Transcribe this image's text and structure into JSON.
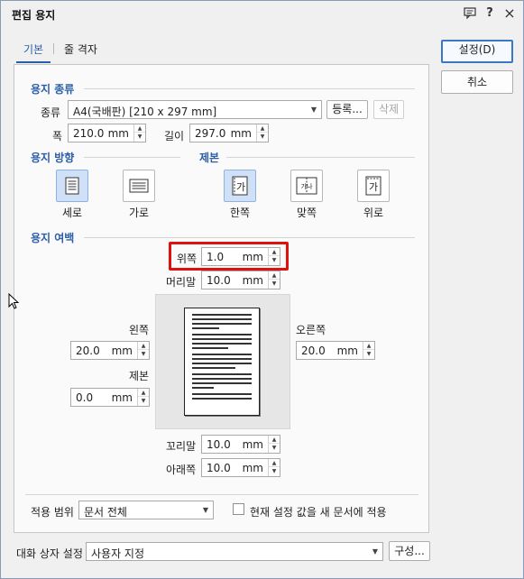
{
  "window": {
    "title": "편집 용지",
    "icons": {
      "help_dialog": "chat-icon",
      "help": "?",
      "close": "×"
    }
  },
  "tabs": [
    {
      "label": "기본"
    },
    {
      "label": "줄 격자"
    }
  ],
  "paper_type": {
    "section": "용지 종류",
    "type_label": "종류",
    "type_value": "A4(국배판) [210 x 297 mm]",
    "register_button": "등록...",
    "delete_button": "삭제",
    "width_label": "폭",
    "width_value": "210.0",
    "width_unit": "mm",
    "height_label": "길이",
    "height_value": "297.0",
    "height_unit": "mm"
  },
  "orientation": {
    "section": "용지 방향",
    "portrait": "세로",
    "landscape": "가로",
    "selected": "세로"
  },
  "binding": {
    "section": "제본",
    "single": "한쪽",
    "facing": "맞쪽",
    "top": "위로",
    "glyph": "가",
    "glyph_pair": "가나",
    "selected": "한쪽"
  },
  "margins": {
    "section": "용지 여백",
    "top_label": "위쪽",
    "top_value": "1.0",
    "top_unit": "mm",
    "header_label": "머리말",
    "header_value": "10.0",
    "header_unit": "mm",
    "left_label": "왼쪽",
    "left_value": "20.0",
    "left_unit": "mm",
    "gutter_label": "제본",
    "gutter_value": "0.0",
    "gutter_unit": "mm",
    "right_label": "오른쪽",
    "right_value": "20.0",
    "right_unit": "mm",
    "footer_label": "꼬리말",
    "footer_value": "10.0",
    "footer_unit": "mm",
    "bottom_label": "아래쪽",
    "bottom_value": "10.0",
    "bottom_unit": "mm"
  },
  "apply": {
    "scope_label": "적용 범위",
    "scope_value": "문서 전체",
    "checkbox_label": "현재 설정 값을 새 문서에 적용",
    "checked": false
  },
  "dialog_setting": {
    "label": "대화 상자 설정",
    "value": "사용자 지정",
    "config_button": "구성..."
  },
  "buttons": {
    "ok": "설정(D)",
    "cancel": "취소"
  },
  "colors": {
    "accent": "#2b5ea8",
    "highlight": "#e01010",
    "selected_bg": "#cfe0f7"
  }
}
